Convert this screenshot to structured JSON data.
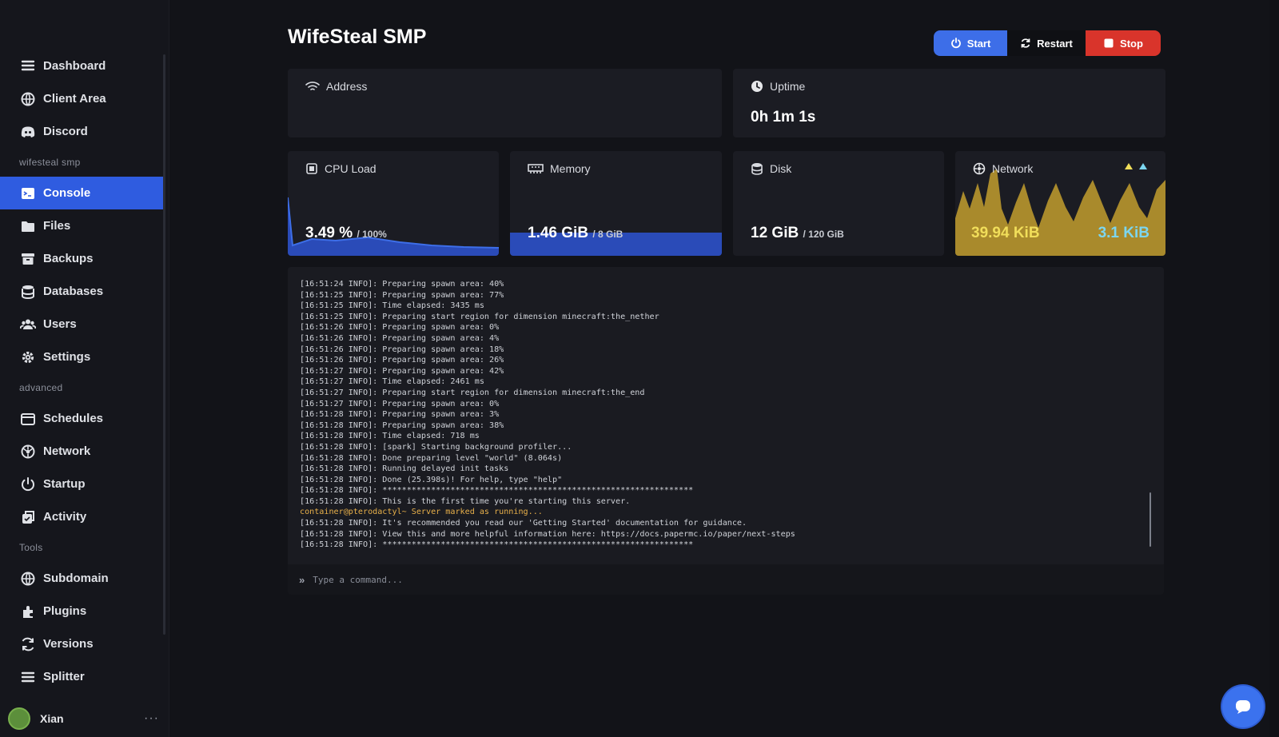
{
  "server": {
    "name": "WifeSteal SMP"
  },
  "controls": {
    "start": "Start",
    "restart": "Restart",
    "stop": "Stop"
  },
  "sidebar": {
    "items": [
      {
        "label": "Dashboard",
        "icon": "dashboard-icon"
      },
      {
        "label": "Client Area",
        "icon": "globe-icon"
      },
      {
        "label": "Discord",
        "icon": "discord-icon"
      }
    ],
    "section_server": "wifesteal smp",
    "server_items": [
      {
        "label": "Console",
        "icon": "terminal-icon",
        "active": true
      },
      {
        "label": "Files",
        "icon": "folder-icon"
      },
      {
        "label": "Backups",
        "icon": "archive-icon"
      },
      {
        "label": "Databases",
        "icon": "database-icon"
      },
      {
        "label": "Users",
        "icon": "users-icon"
      },
      {
        "label": "Settings",
        "icon": "gear-icon"
      }
    ],
    "section_advanced": "advanced",
    "advanced_items": [
      {
        "label": "Schedules",
        "icon": "calendar-icon"
      },
      {
        "label": "Network",
        "icon": "network-icon"
      },
      {
        "label": "Startup",
        "icon": "power-icon"
      },
      {
        "label": "Activity",
        "icon": "activity-icon"
      }
    ],
    "section_tools": "Tools",
    "tool_items": [
      {
        "label": "Subdomain",
        "icon": "globe-icon"
      },
      {
        "label": "Plugins",
        "icon": "puzzle-icon"
      },
      {
        "label": "Versions",
        "icon": "refresh-icon"
      },
      {
        "label": "Splitter",
        "icon": "split-icon"
      }
    ],
    "user": {
      "name": "Xian",
      "more": "···"
    }
  },
  "stats": {
    "address": {
      "label": "Address",
      "value": ""
    },
    "uptime": {
      "label": "Uptime",
      "value": "0h 1m 1s"
    },
    "cpu": {
      "label": "CPU Load",
      "value": "3.49 %",
      "limit": "/ 100%",
      "fraction": 0.0349
    },
    "memory": {
      "label": "Memory",
      "value": "1.46 GiB",
      "limit": "/ 8 GiB",
      "fraction": 0.1825
    },
    "disk": {
      "label": "Disk",
      "value": "12 GiB",
      "limit": "/ 120 GiB",
      "fraction": 0.1
    },
    "network": {
      "label": "Network",
      "up": "39.94 KiB",
      "down": "3.1 KiB"
    }
  },
  "colors": {
    "accent": "#2f5ce0",
    "start": "#3d6ee8",
    "stop": "#d9342b",
    "network_fill": "#a98a2c",
    "network_up": "#f1de5a",
    "network_down": "#7cd6f0",
    "cpu_fill": "#2a4bb8"
  },
  "console": {
    "lines": [
      "[16:51:24 INFO]: Preparing spawn area: 40%",
      "[16:51:25 INFO]: Preparing spawn area: 77%",
      "[16:51:25 INFO]: Time elapsed: 3435 ms",
      "[16:51:25 INFO]: Preparing start region for dimension minecraft:the_nether",
      "[16:51:26 INFO]: Preparing spawn area: 0%",
      "[16:51:26 INFO]: Preparing spawn area: 4%",
      "[16:51:26 INFO]: Preparing spawn area: 18%",
      "[16:51:26 INFO]: Preparing spawn area: 26%",
      "[16:51:27 INFO]: Preparing spawn area: 42%",
      "[16:51:27 INFO]: Time elapsed: 2461 ms",
      "[16:51:27 INFO]: Preparing start region for dimension minecraft:the_end",
      "[16:51:27 INFO]: Preparing spawn area: 0%",
      "[16:51:28 INFO]: Preparing spawn area: 3%",
      "[16:51:28 INFO]: Preparing spawn area: 38%",
      "[16:51:28 INFO]: Time elapsed: 718 ms",
      "[16:51:28 INFO]: [spark] Starting background profiler...",
      "[16:51:28 INFO]: Done preparing level \"world\" (8.064s)",
      "[16:51:28 INFO]: Running delayed init tasks",
      "[16:51:28 INFO]: Done (25.398s)! For help, type \"help\"",
      "[16:51:28 INFO]: ****************************************************************",
      "[16:51:28 INFO]: This is the first time you're starting this server.",
      "container@pterodactyl~ Server marked as running...",
      "[16:51:28 INFO]: It's recommended you read our 'Getting Started' documentation for guidance.",
      "[16:51:28 INFO]: View this and more helpful information here: https://docs.papermc.io/paper/next-steps",
      "[16:51:28 INFO]: ****************************************************************"
    ],
    "placeholder": "Type a command..."
  }
}
